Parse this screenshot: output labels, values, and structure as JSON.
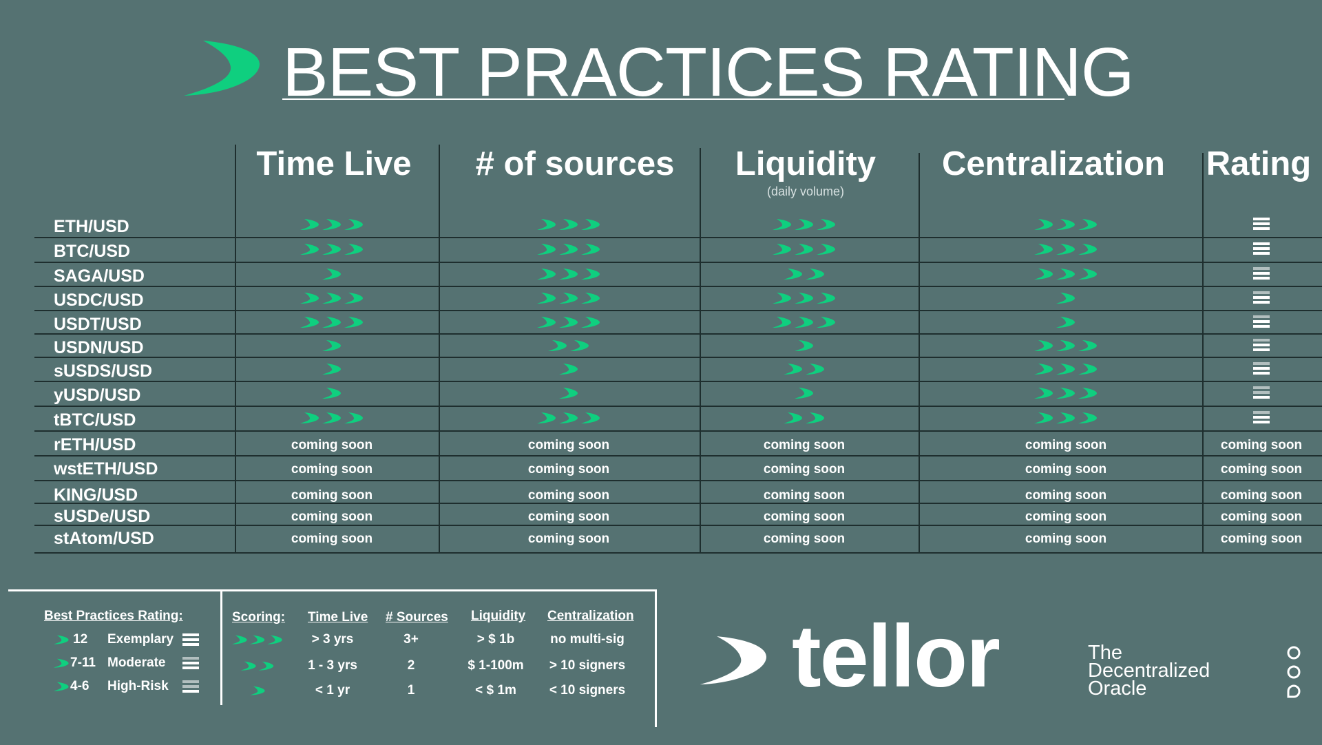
{
  "title": "BEST PRACTICES RATING",
  "colors": {
    "background": "#557272",
    "accent": "#0fcf7f",
    "line": "#1e2e2e",
    "text": "#ffffff"
  },
  "columns": {
    "time_live": "Time Live",
    "sources": "# of sources",
    "liquidity": "Liquidity",
    "liquidity_sub": "(daily volume)",
    "centralization": "Centralization",
    "rating": "Rating"
  },
  "rows": [
    {
      "pair": "ETH/USD",
      "time_live": 3,
      "sources": 3,
      "liquidity": 3,
      "centralization": 3,
      "rating": "exemplary"
    },
    {
      "pair": "BTC/USD",
      "time_live": 3,
      "sources": 3,
      "liquidity": 3,
      "centralization": 3,
      "rating": "exemplary"
    },
    {
      "pair": "SAGA/USD",
      "time_live": 1,
      "sources": 3,
      "liquidity": 2,
      "centralization": 3,
      "rating": "moderate"
    },
    {
      "pair": "USDC/USD",
      "time_live": 3,
      "sources": 3,
      "liquidity": 3,
      "centralization": 1,
      "rating": "moderate"
    },
    {
      "pair": "USDT/USD",
      "time_live": 3,
      "sources": 3,
      "liquidity": 3,
      "centralization": 1,
      "rating": "moderate"
    },
    {
      "pair": "USDN/USD",
      "time_live": 1,
      "sources": 2,
      "liquidity": 1,
      "centralization": 3,
      "rating": "moderate"
    },
    {
      "pair": "sUSDS/USD",
      "time_live": 1,
      "sources": 1,
      "liquidity": 2,
      "centralization": 3,
      "rating": "moderate"
    },
    {
      "pair": "yUSD/USD",
      "time_live": 1,
      "sources": 1,
      "liquidity": 1,
      "centralization": 3,
      "rating": "high-risk"
    },
    {
      "pair": "tBTC/USD",
      "time_live": 3,
      "sources": 3,
      "liquidity": 2,
      "centralization": 3,
      "rating": "moderate"
    },
    {
      "pair": "rETH/USD",
      "coming_soon": "coming soon"
    },
    {
      "pair": "wstETH/USD",
      "coming_soon": "coming soon"
    },
    {
      "pair": "KING/USD",
      "coming_soon": "coming soon"
    },
    {
      "pair": "sUSDe/USD",
      "coming_soon": "coming soon"
    },
    {
      "pair": "stAtom/USD",
      "coming_soon": "coming soon"
    }
  ],
  "legend": {
    "heading": "Best Practices Rating:",
    "levels": [
      {
        "score": "12",
        "label": "Exemplary",
        "icon": "rating-exemplary-icon"
      },
      {
        "score": "7-11",
        "label": "Moderate",
        "icon": "rating-moderate-icon"
      },
      {
        "score": "4-6",
        "label": "High-Risk",
        "icon": "rating-high-risk-icon"
      }
    ],
    "scoring_heading": "Scoring:",
    "headers": {
      "time_live": "Time Live",
      "sources": "# Sources",
      "liquidity": "Liquidity",
      "centralization": "Centralization"
    },
    "scoring_rows": [
      {
        "arrows": 3,
        "time_live": "> 3 yrs",
        "sources": "3+",
        "liquidity": "> $ 1b",
        "centralization": "no multi-sig"
      },
      {
        "arrows": 2,
        "time_live": "1 - 3 yrs",
        "sources": "2",
        "liquidity": "$ 1-100m",
        "centralization": "> 10 signers"
      },
      {
        "arrows": 1,
        "time_live": "< 1 yr",
        "sources": "1",
        "liquidity": "< $ 1m",
        "centralization": "<  10 signers"
      }
    ]
  },
  "brand": {
    "name": "tellor",
    "tagline_1": "The",
    "tagline_2": "Decentralized",
    "tagline_3": "Oracle"
  }
}
